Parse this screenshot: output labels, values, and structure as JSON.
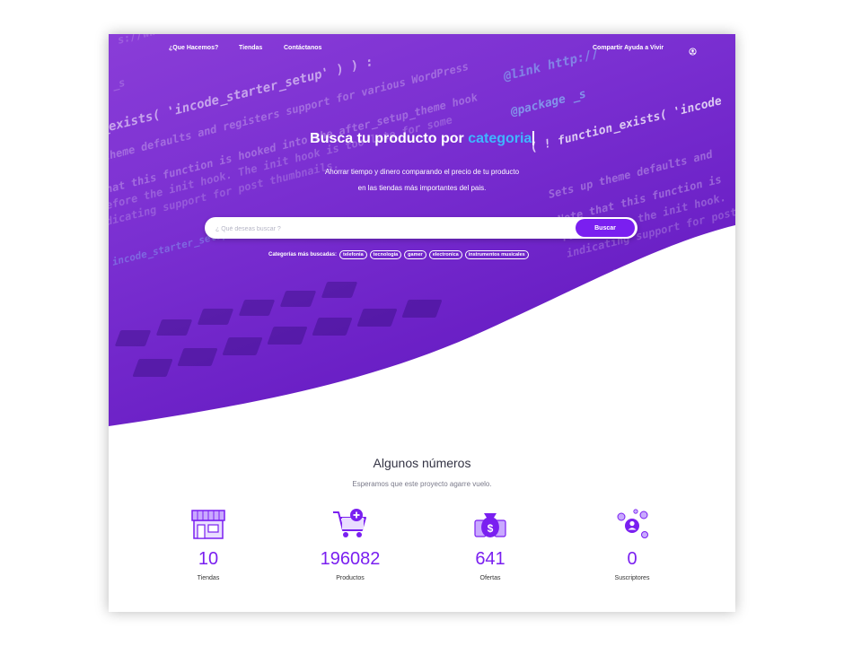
{
  "nav": {
    "items": [
      "¿Que Hacemos?",
      "Tiendas",
      "Contáctanos"
    ],
    "right_link": "Compartir Ayuda a Vivir"
  },
  "hero": {
    "title_prefix": "Busca tu producto por",
    "title_highlight": "categoria",
    "subtitle_line1": "Ahorrar tiempo y dinero comparando el precio de tu producto",
    "subtitle_line2": "en las tiendas más importantes del pais."
  },
  "background_code": [
    "s://ww",
    "_s",
    "_exists( 'incode_starter_setup' ) ) :",
    "function_exists( 'incode_starter_setup' ) ) :",
    "theme defaults and registers support for various WordPress",
    "that this function is hooked into the after_setup_theme hook",
    "before the init hook. The init hook is too late for some",
    "ndicating support for post thumbnails.",
    "incode_starter_setup() {",
    "@link http://",
    "@package _s",
    "Sets up theme defaults and",
    "Note that this function is",
    "runs before the init hook.",
    "indicating support for post",
    "incode_starter_setup",
    "( ! function_exists( 'incode"
  ],
  "search": {
    "placeholder": "¿ Qué deseas buscar ?",
    "button_label": "Buscar"
  },
  "categories": {
    "label": "Categorías más buscadas:",
    "tags": [
      "telefonia",
      "tecnologia",
      "gamer",
      "electronica",
      "instrumentos musicales"
    ]
  },
  "numbers": {
    "title": "Algunos números",
    "subtitle": "Esperamos que este proyecto agarre vuelo.",
    "stats": [
      {
        "value": "10",
        "label": "Tiendas",
        "icon": "store-icon"
      },
      {
        "value": "196082",
        "label": "Productos",
        "icon": "shopping-cart-icon"
      },
      {
        "value": "641",
        "label": "Ofertas",
        "icon": "money-bag-icon"
      },
      {
        "value": "0",
        "label": "Suscriptores",
        "icon": "subscribers-icon"
      }
    ]
  },
  "colors": {
    "primary": "#7a1ff0",
    "hero_purple": "#7a2fd1",
    "highlight": "#3fb6ff"
  }
}
